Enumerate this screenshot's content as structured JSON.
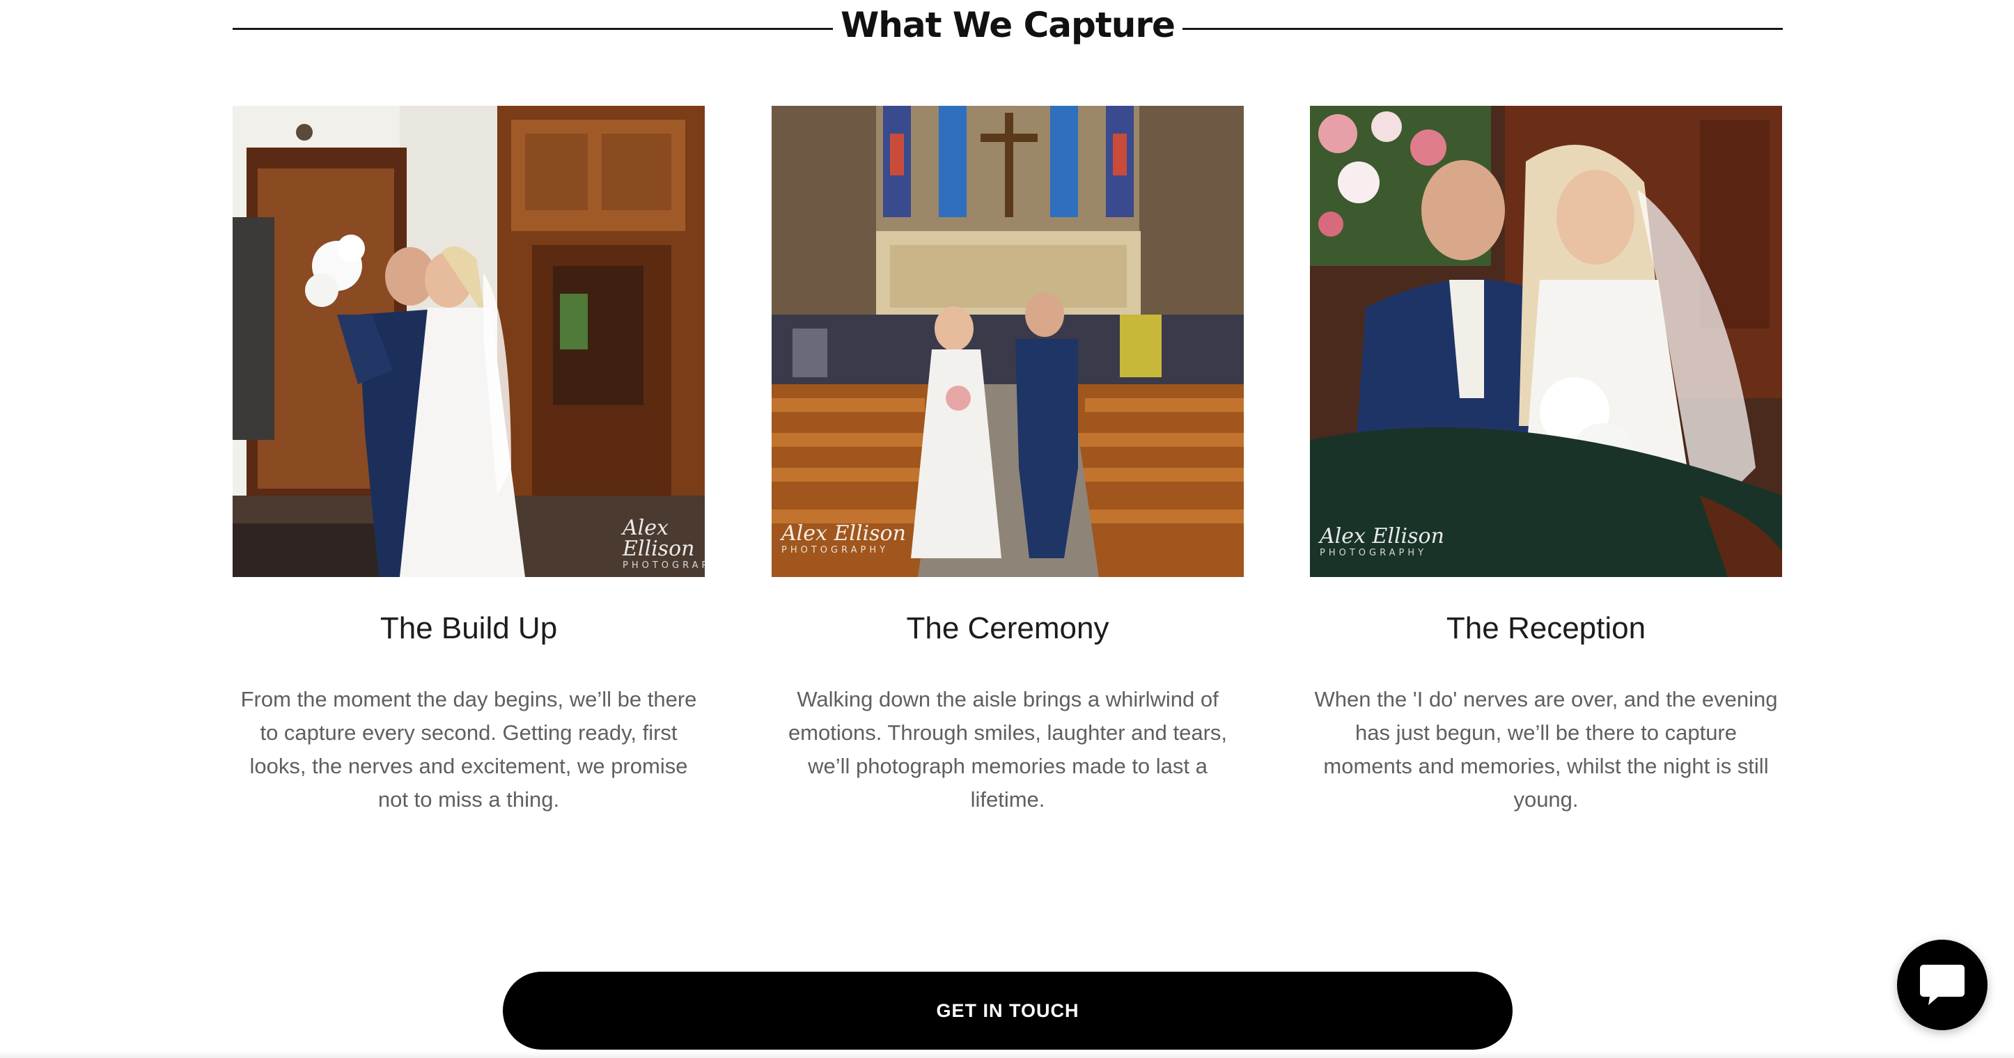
{
  "section": {
    "title": "What We Capture"
  },
  "cards": [
    {
      "title": "The Build Up",
      "description": "From the moment the day begins, we’ll be there to capture every second. Getting ready, first looks, the nerves and excitement, we promise not to miss a thing.",
      "photo_alt": "Groom lifting bride in embrace at doorway"
    },
    {
      "title": "The Ceremony",
      "description": "Walking down the aisle brings a whirlwind of emotions. Through smiles, laughter and tears, we’ll photograph memories made to last a lifetime.",
      "photo_alt": "Bride and groom walking down church aisle"
    },
    {
      "title": "The Reception",
      "description": "When the 'I do' nerves are over, and the evening has just begun, we’ll be there to capture moments and memories, whilst the night is still young.",
      "photo_alt": "Bride and groom smiling seated at table"
    }
  ],
  "watermark": {
    "script": "Alex Ellison",
    "sub": "PHOTOGRAPHY"
  },
  "cta": {
    "label": "GET IN TOUCH"
  },
  "colors": {
    "heading": "#111111",
    "body_text": "#5f5f5f",
    "button_bg": "#000000",
    "button_text": "#ffffff"
  },
  "icons": {
    "chat": "chat-bubble-icon"
  }
}
